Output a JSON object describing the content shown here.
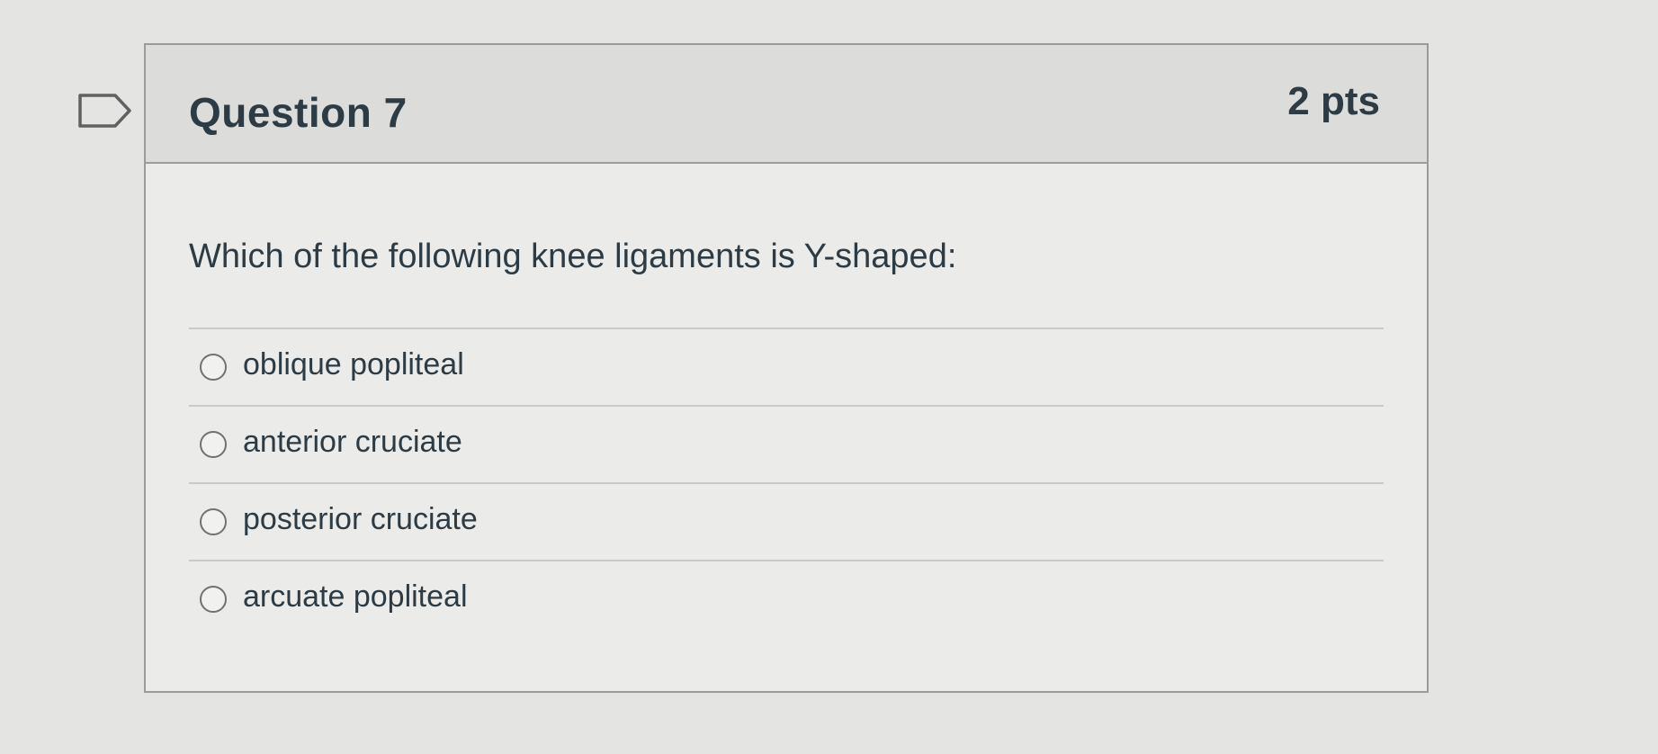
{
  "question": {
    "title": "Question 7",
    "points": "2 pts",
    "text": "Which of the following knee ligaments is Y-shaped:",
    "flag_icon": "bookmark-flag-icon",
    "answers": [
      {
        "label": "oblique popliteal"
      },
      {
        "label": "anterior cruciate"
      },
      {
        "label": "posterior cruciate"
      },
      {
        "label": "arcuate popliteal"
      }
    ]
  }
}
